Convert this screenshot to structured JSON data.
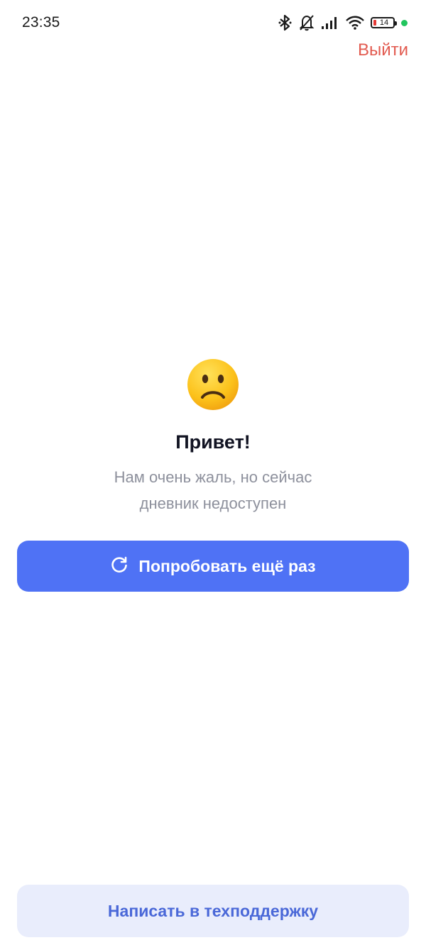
{
  "status_bar": {
    "time": "23:35",
    "battery_level": "14",
    "icons": [
      "bluetooth-icon",
      "bell-off-icon",
      "signal-icon",
      "wifi-icon",
      "battery-icon"
    ],
    "indicator_color": "#22c55e"
  },
  "header": {
    "logout_label": "Выйти"
  },
  "error": {
    "emoji": "slightly-frowning-face-icon",
    "title": "Привет!",
    "message_line1": "Нам очень жаль, но сейчас",
    "message_line2": "дневник недоступен"
  },
  "actions": {
    "retry_label": "Попробовать ещё раз",
    "support_label": "Написать в техподдержку"
  },
  "colors": {
    "accent": "#4f72f5",
    "danger": "#e25a4f",
    "support_bg": "#e9edfc",
    "support_text": "#4a68d8"
  }
}
